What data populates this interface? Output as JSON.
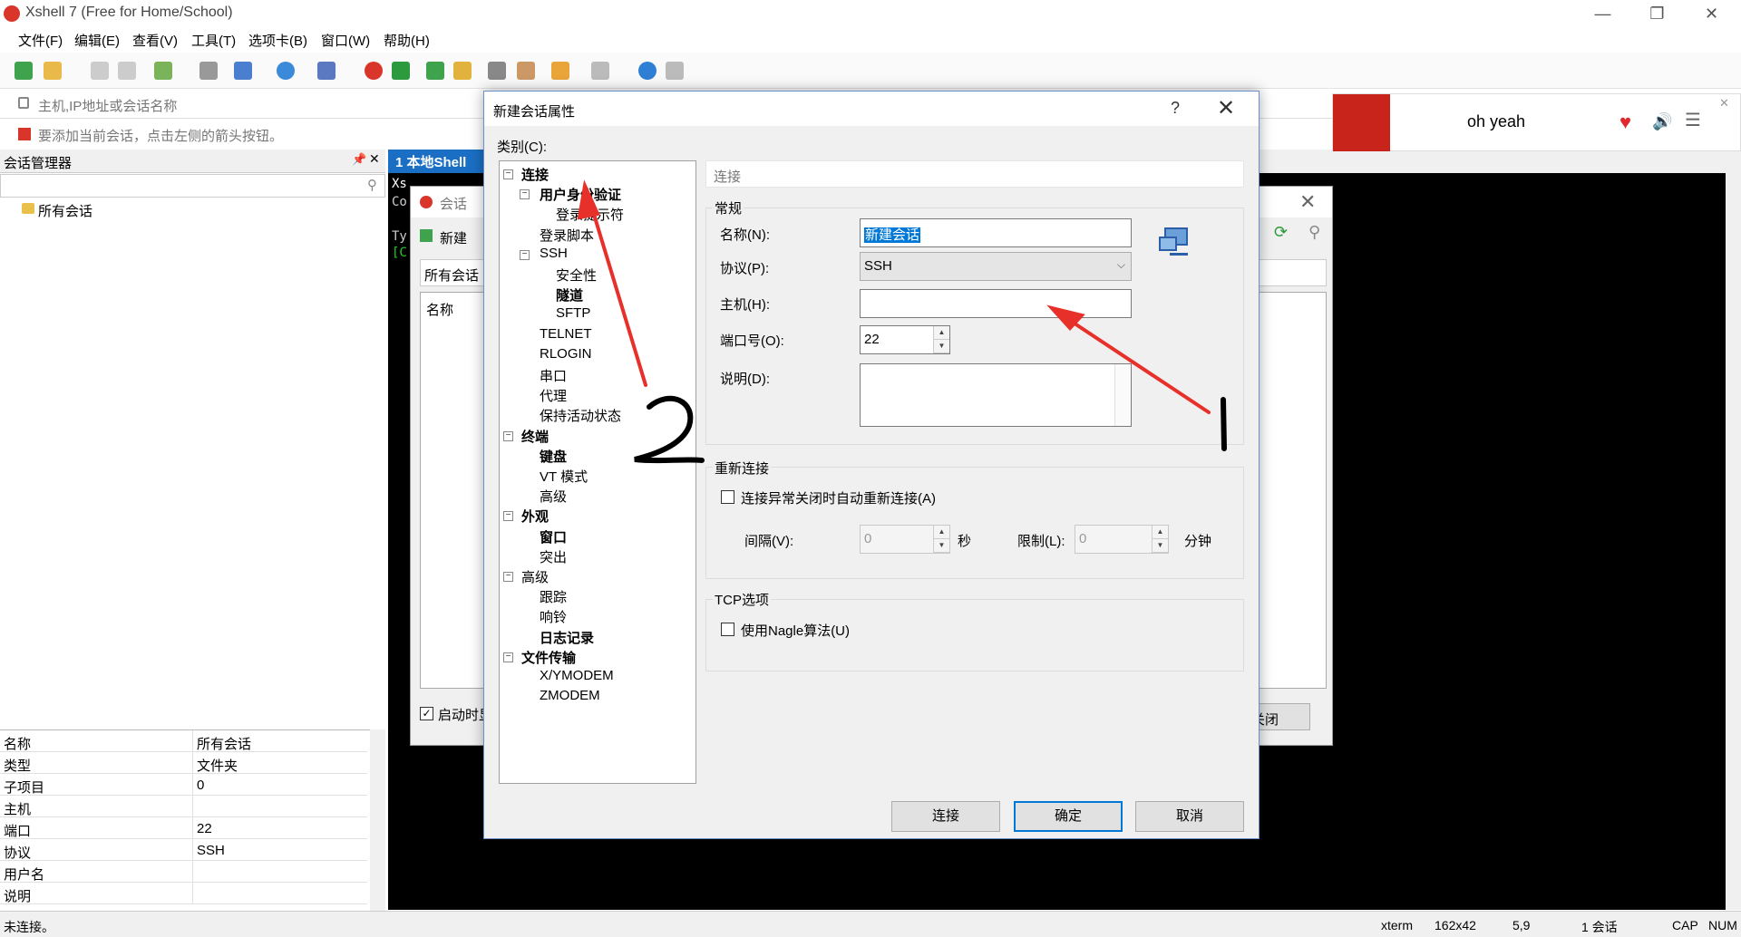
{
  "app": {
    "title": "Xshell 7 (Free for Home/School)"
  },
  "menu": [
    "文件(F)",
    "编辑(E)",
    "查看(V)",
    "工具(T)",
    "选项卡(B)",
    "窗口(W)",
    "帮助(H)"
  ],
  "address": {
    "placeholder": "主机,IP地址或会话名称",
    "hint": "要添加当前会话，点击左侧的箭头按钮。"
  },
  "session_manager": {
    "title": "会话管理器",
    "tree_root": "所有会话"
  },
  "properties": [
    {
      "k": "名称",
      "v": "所有会话"
    },
    {
      "k": "类型",
      "v": "文件夹"
    },
    {
      "k": "子项目",
      "v": "0"
    },
    {
      "k": "主机",
      "v": ""
    },
    {
      "k": "端口",
      "v": "22"
    },
    {
      "k": "协议",
      "v": "SSH"
    },
    {
      "k": "用户名",
      "v": ""
    },
    {
      "k": "说明",
      "v": ""
    }
  ],
  "tab": {
    "label": "1 本地Shell"
  },
  "terminal": {
    "l1": "Xs",
    "l2": "Co",
    "l3": "Ty",
    "l4": "[C"
  },
  "bg_dialog": {
    "title": "会话",
    "new_label": "新建",
    "all_sessions": "所有会话",
    "name_col": "名称",
    "startup": "启动时显",
    "close": "关闭"
  },
  "music": {
    "song": "oh yeah"
  },
  "statusbar": {
    "left": "未连接。",
    "term": "xterm",
    "size": "162x42",
    "pos": "5,9",
    "sessions": "1 会话",
    "cap": "CAP",
    "num": "NUM"
  },
  "dialog": {
    "title": "新建会话属性",
    "help": "?",
    "category_label": "类别(C):",
    "section_title": "连接",
    "general": "常规",
    "name_label": "名称(N):",
    "name_value": "新建会话",
    "protocol_label": "协议(P):",
    "protocol_value": "SSH",
    "host_label": "主机(H):",
    "host_value": "",
    "port_label": "端口号(O):",
    "port_value": "22",
    "desc_label": "说明(D):",
    "reconnect": "重新连接",
    "reconnect_check": "连接异常关闭时自动重新连接(A)",
    "interval_label": "间隔(V):",
    "interval_value": "0",
    "interval_unit": "秒",
    "limit_label": "限制(L):",
    "limit_value": "0",
    "limit_unit": "分钟",
    "tcp": "TCP选项",
    "nagle": "使用Nagle算法(U)",
    "connect_btn": "连接",
    "ok_btn": "确定",
    "cancel_btn": "取消"
  },
  "tree": [
    {
      "label": "连接",
      "bold": true,
      "level": 0,
      "exp": true
    },
    {
      "label": "用户身份验证",
      "bold": true,
      "level": 1,
      "exp": true
    },
    {
      "label": "登录提示符",
      "bold": false,
      "level": 2
    },
    {
      "label": "登录脚本",
      "bold": false,
      "level": 1
    },
    {
      "label": "SSH",
      "bold": false,
      "level": 1,
      "exp": true
    },
    {
      "label": "安全性",
      "bold": false,
      "level": 2
    },
    {
      "label": "隧道",
      "bold": true,
      "level": 2
    },
    {
      "label": "SFTP",
      "bold": false,
      "level": 2
    },
    {
      "label": "TELNET",
      "bold": false,
      "level": 1
    },
    {
      "label": "RLOGIN",
      "bold": false,
      "level": 1
    },
    {
      "label": "串口",
      "bold": false,
      "level": 1
    },
    {
      "label": "代理",
      "bold": false,
      "level": 1
    },
    {
      "label": "保持活动状态",
      "bold": false,
      "level": 1
    },
    {
      "label": "终端",
      "bold": true,
      "level": 0,
      "exp": true
    },
    {
      "label": "键盘",
      "bold": true,
      "level": 1
    },
    {
      "label": "VT 模式",
      "bold": false,
      "level": 1
    },
    {
      "label": "高级",
      "bold": false,
      "level": 1
    },
    {
      "label": "外观",
      "bold": true,
      "level": 0,
      "exp": true
    },
    {
      "label": "窗口",
      "bold": true,
      "level": 1
    },
    {
      "label": "突出",
      "bold": false,
      "level": 1
    },
    {
      "label": "高级",
      "bold": false,
      "level": 0,
      "exp": true
    },
    {
      "label": "跟踪",
      "bold": false,
      "level": 1
    },
    {
      "label": "响铃",
      "bold": false,
      "level": 1
    },
    {
      "label": "日志记录",
      "bold": true,
      "level": 1
    },
    {
      "label": "文件传输",
      "bold": true,
      "level": 0,
      "exp": true
    },
    {
      "label": "X/YMODEM",
      "bold": false,
      "level": 1
    },
    {
      "label": "ZMODEM",
      "bold": false,
      "level": 1
    }
  ],
  "colors": {
    "accent": "#0078d7",
    "tab": "#1a6fc4",
    "annotation": "#e8302a"
  }
}
